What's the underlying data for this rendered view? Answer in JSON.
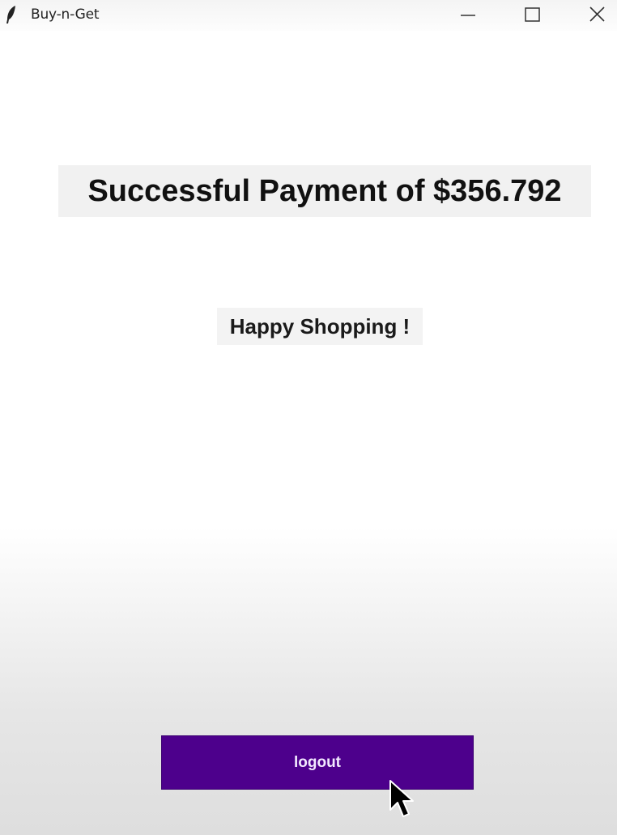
{
  "window": {
    "title": "Buy-n-Get",
    "app_icon": "feather-icon",
    "controls": {
      "minimize_icon": "minimize-icon",
      "maximize_icon": "maximize-icon",
      "close_icon": "close-icon"
    }
  },
  "main": {
    "payment_message": "Successful Payment of $356.792",
    "greeting": "Happy Shopping !",
    "logout_label": "logout"
  },
  "colors": {
    "logout_button": "#4d008c",
    "logout_text": "#f2e9ff",
    "label_background": "#f1f1f1"
  },
  "cursor": "arrow-cursor-icon"
}
